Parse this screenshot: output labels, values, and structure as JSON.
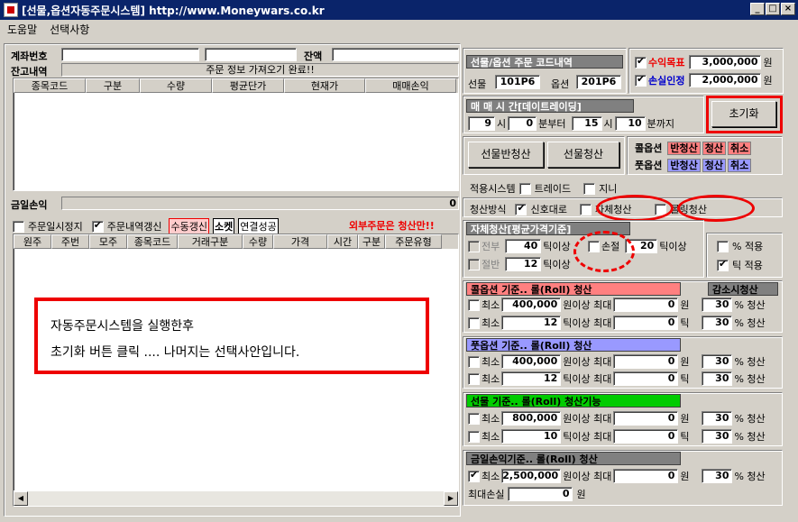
{
  "window": {
    "title": "[선물,옵션자동주문시스템] http://www.Moneywars.co.kr"
  },
  "menu": [
    "도움말",
    "선택사항"
  ],
  "left": {
    "account_label": "계좌번호",
    "balance_label": "잔액",
    "holdings_label": "잔고내역",
    "status_msg": "주문 정보 가져오기 완료!!",
    "holding_cols": [
      "종목코드",
      "구분",
      "수량",
      "평균단가",
      "현재가",
      "매매손익"
    ],
    "today_pl_label": "금일손익",
    "today_pl_value": "0",
    "chk_pause": "주문일시정지",
    "chk_refresh": "주문내역갱신",
    "manual_refresh": "수동갱신",
    "socket_label": "소켓",
    "socket_status": "연결성공",
    "external_order_warn": "외부주문은 청산만!!",
    "order_cols": [
      "원주",
      "주번",
      "모주",
      "종목코드",
      "거래구분",
      "수량",
      "가격",
      "시간",
      "구분",
      "주문유형"
    ],
    "note_line1": "자동주문시스템을 실행한후",
    "note_line2": "초기화 버튼 클릭 ....  나머지는 선택사안입니다."
  },
  "code": {
    "header": "선물/옵션 주문 코드내역",
    "futures_label": "선물",
    "futures_code": "101P6",
    "options_label": "옵션",
    "options_code": "201P6"
  },
  "target": {
    "profit_label": "수익목표",
    "profit_value": "3,000,000",
    "loss_label": "손실인정",
    "loss_value": "2,000,000",
    "unit": "원"
  },
  "time": {
    "header": "매 매 시 간[데이트레이딩]",
    "h1": "9",
    "m1": "0",
    "sep1": "시",
    "sep2": "분부터",
    "h2": "15",
    "m2": "10",
    "sep3": "시",
    "sep4": "분까지"
  },
  "reset_button": "초기화",
  "btn_futures_rev": "선물반청산",
  "btn_futures_clear": "선물청산",
  "call_row": {
    "label": "콜옵션",
    "a": "반청산",
    "b": "청산",
    "c": "취소"
  },
  "put_row": {
    "label": "풋옵션",
    "a": "반청산",
    "b": "청산",
    "c": "취소"
  },
  "apply": {
    "label": "적용시스템",
    "trade": "트레이드",
    "jinni": "지니"
  },
  "clear_method": {
    "label": "청산방식",
    "signal": "신호대로",
    "self": "자체청산",
    "rolling": "롤링청산"
  },
  "self_clear": {
    "header": "자체청산[평균가격기준]",
    "all": "전부",
    "all_val": "40",
    "tick_over": "틱이상",
    "half": "절반",
    "half_val": "12",
    "loss": "손절",
    "loss_val": "20",
    "pct_apply": "% 적용",
    "tick_apply": "틱 적용"
  },
  "call_roll": {
    "header": "콜옵션 기준.. 롤(Roll) 청산",
    "decrease": "감소시청산",
    "min": "최소",
    "v1": "400,000",
    "won_over": "원이상 최대",
    "m1": "0",
    "won": "원",
    "r1": "30",
    "pct": "% 청산",
    "v2": "12",
    "tick_over": "틱이상 최대",
    "m2": "0",
    "tick": "틱",
    "r2": "30"
  },
  "put_roll": {
    "header": "풋옵션 기준.. 롤(Roll) 청산",
    "v1": "400,000",
    "m1": "0",
    "r1": "30",
    "v2": "12",
    "m2": "0",
    "r2": "30"
  },
  "fut_roll": {
    "header": "선물 기준.. 롤(Roll) 청산기능",
    "v1": "800,000",
    "m1": "0",
    "r1": "30",
    "v2": "10",
    "m2": "0",
    "r2": "30"
  },
  "pl_roll": {
    "header": "금일손익기준.. 롤(Roll) 청산",
    "v1": "2,500,000",
    "m1": "0",
    "r1": "30",
    "maxloss_label": "최대손실",
    "maxloss_val": "0"
  },
  "colors": {
    "red_ring": "#ee0000",
    "call_hdr": "#ff8080",
    "put_hdr": "#9999ff",
    "fut_hdr": "#00cc00"
  }
}
